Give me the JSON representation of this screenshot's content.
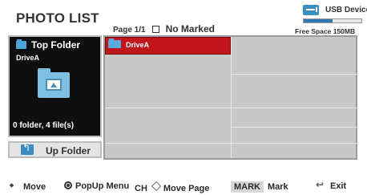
{
  "header": {
    "title": "PHOTO LIST",
    "page_info": "Page 1/1",
    "marked_label": "No Marked"
  },
  "device": {
    "label": "USB Device",
    "free_space": "Free Space 150MB",
    "usage_fraction": 0.5,
    "accent_color": "#2f78b0"
  },
  "left_panel": {
    "top_folder_label": "Top Folder",
    "drive_name": "DriveA",
    "file_count": "0 folder, 4 file(s)",
    "up_folder_label": "Up Folder"
  },
  "grid": {
    "cells": [
      {
        "label": "DriveA",
        "selected": true
      },
      {
        "label": "",
        "selected": false
      },
      {
        "label": "",
        "selected": false
      },
      {
        "label": "",
        "selected": false
      },
      {
        "label": "",
        "selected": false
      },
      {
        "label": "",
        "selected": false
      },
      {
        "label": "",
        "selected": false
      },
      {
        "label": "",
        "selected": false
      }
    ],
    "selection_color": "#c0151b"
  },
  "footer": {
    "move_label": "Move",
    "popup_label": "PopUp Menu",
    "ch_label": "CH",
    "move_page_label": "Move Page",
    "mark_key": "MARK",
    "mark_label": "Mark",
    "exit_label": "Exit"
  }
}
